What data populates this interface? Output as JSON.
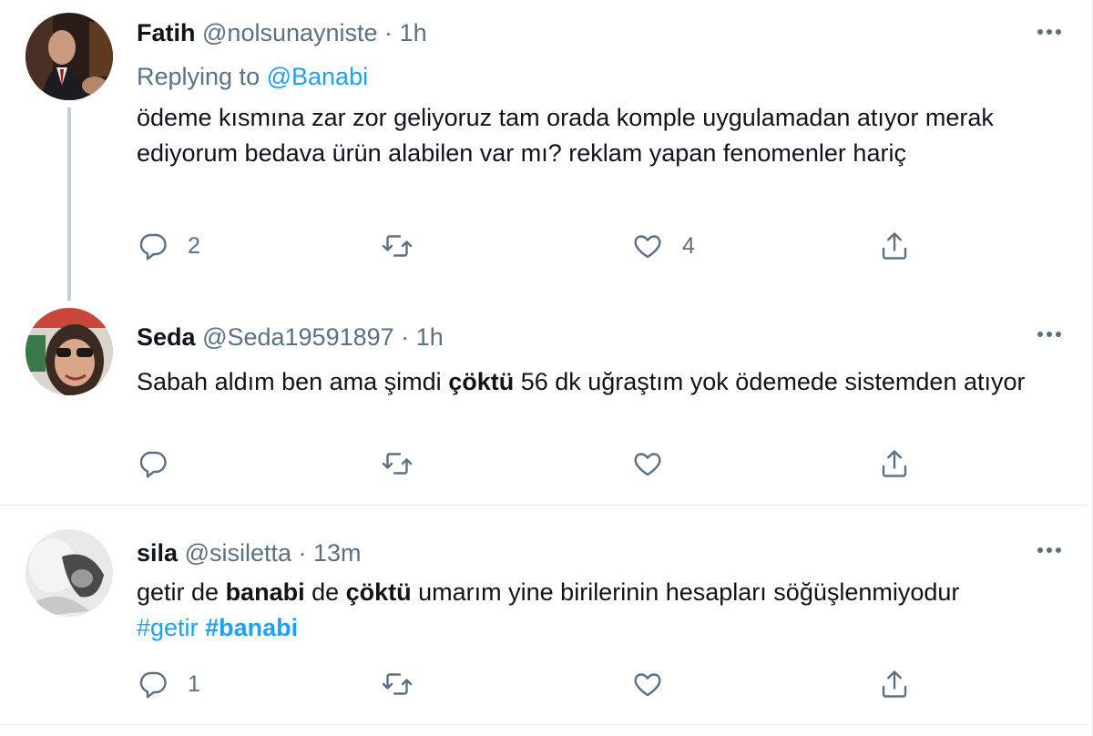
{
  "colors": {
    "accent": "#1da1f2",
    "secondary_text": "#5b7083",
    "primary_text": "#0f1419",
    "thread_line": "#c4cfd6"
  },
  "tweets": [
    {
      "name": "Fatih",
      "handle": "@nolsunayniste",
      "time": "1h",
      "replying_prefix": "Replying to",
      "replying_to": "@Banabi",
      "text": "ödeme kısmına zar zor geliyoruz tam orada komple uygulamadan atıyor merak ediyorum bedava ürün alabilen var mı? reklam yapan fenomenler hariç",
      "reply_count": "2",
      "retweet_count": "",
      "like_count": "4"
    },
    {
      "name": "Seda",
      "handle": "@Seda19591897",
      "time": "1h",
      "text_parts": [
        "Sabah aldım ben ama şimdi ",
        "çöktü",
        " 56 dk uğraştım yok ödemede sistemden atıyor"
      ],
      "reply_count": "",
      "retweet_count": "",
      "like_count": ""
    },
    {
      "name": "sila",
      "handle": "@sisiletta",
      "time": "13m",
      "text_parts": [
        "getir de ",
        "banabi",
        " de ",
        "çöktü",
        " umarım yine birilerinin hesapları söğüşlenmiyodur"
      ],
      "hashtags": [
        "#getir",
        "#banabi"
      ],
      "reply_count": "1",
      "retweet_count": "",
      "like_count": ""
    }
  ],
  "separator": " · ",
  "icons": [
    "reply-icon",
    "retweet-icon",
    "like-icon",
    "share-icon",
    "more-icon"
  ]
}
